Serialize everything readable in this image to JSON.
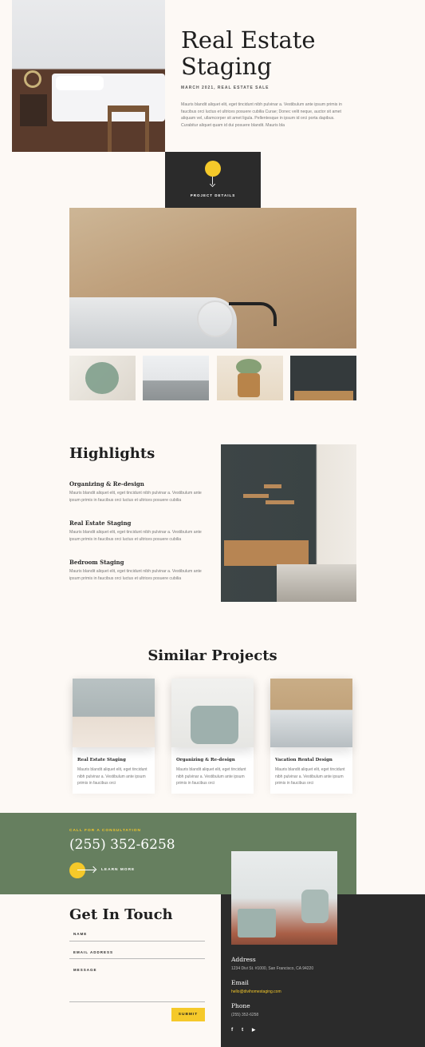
{
  "hero": {
    "title_line1": "Real Estate",
    "title_line2": "Staging",
    "meta": "MARCH 2021, REAL ESTATE SALE",
    "intro": "Mauris blandit aliquet elit, eget tincidunt nibh pulvinar a. Vestibulum ante ipsum primis in faucibus orci luctus et ultrices posuere cubilia Curae; Donec velit neque, auctor sit amet aliquam vel, ullamcorper sit amet ligula. Pellentesque in ipsum id orci porta dapibus. Curabitur aliquet quam id dui posuere blandit. Mauris bla",
    "details_label": "PROJECT DETAILS"
  },
  "highlights": {
    "title": "Highlights",
    "items": [
      {
        "heading": "Organizing & Re-design",
        "text": "Mauris blandit aliquet elit, eget tincidunt nibh pulvinar a. Vestibulum ante ipsum primis in faucibus orci luctus et ultrices posuere cubilia"
      },
      {
        "heading": "Real Estate Staging",
        "text": "Mauris blandit aliquet elit, eget tincidunt nibh pulvinar a. Vestibulum ante ipsum primis in faucibus orci luctus et ultrices posuere cubilia"
      },
      {
        "heading": "Bedroom Staging",
        "text": "Mauris blandit aliquet elit, eget tincidunt nibh pulvinar a. Vestibulum ante ipsum primis in faucibus orci luctus et ultrices posuere cubilia"
      }
    ]
  },
  "similar": {
    "title": "Similar Projects",
    "cards": [
      {
        "heading": "Real Estate Staging",
        "text": "Mauris blandit aliquet elit, eget tincidunt nibh pulvinar a. Vestibulum ante ipsum primis in faucibus orci"
      },
      {
        "heading": "Organizing & Re-design",
        "text": "Mauris blandit aliquet elit, eget tincidunt nibh pulvinar a. Vestibulum ante ipsum primis in faucibus orci"
      },
      {
        "heading": "Vacation Rental Design",
        "text": "Mauris blandit aliquet elit, eget tincidunt nibh pulvinar a. Vestibulum ante ipsum primis in faucibus orci"
      }
    ]
  },
  "cta": {
    "label": "CALL FOR A CONSULTATION",
    "phone": "(255) 352-6258",
    "learn_more": "LEARN MORE"
  },
  "contact": {
    "title": "Get In Touch",
    "name_label": "NAME",
    "email_label": "EMAIL ADDRESS",
    "message_label": "MESSAGE",
    "submit": "SUBMIT",
    "address_h": "Address",
    "address": "1234 Divi St. #1000, San Francisco, CA 94220",
    "email_h": "Email",
    "email": "hello@divihomestaging.com",
    "phone_h": "Phone",
    "phone": "(255) 352-6258",
    "social": {
      "facebook": "f",
      "twitter": "t",
      "youtube": "▶"
    }
  },
  "colors": {
    "accent": "#f5c92a",
    "dark": "#2b2b2b",
    "green": "#667f5f",
    "background": "#fdf9f5"
  }
}
